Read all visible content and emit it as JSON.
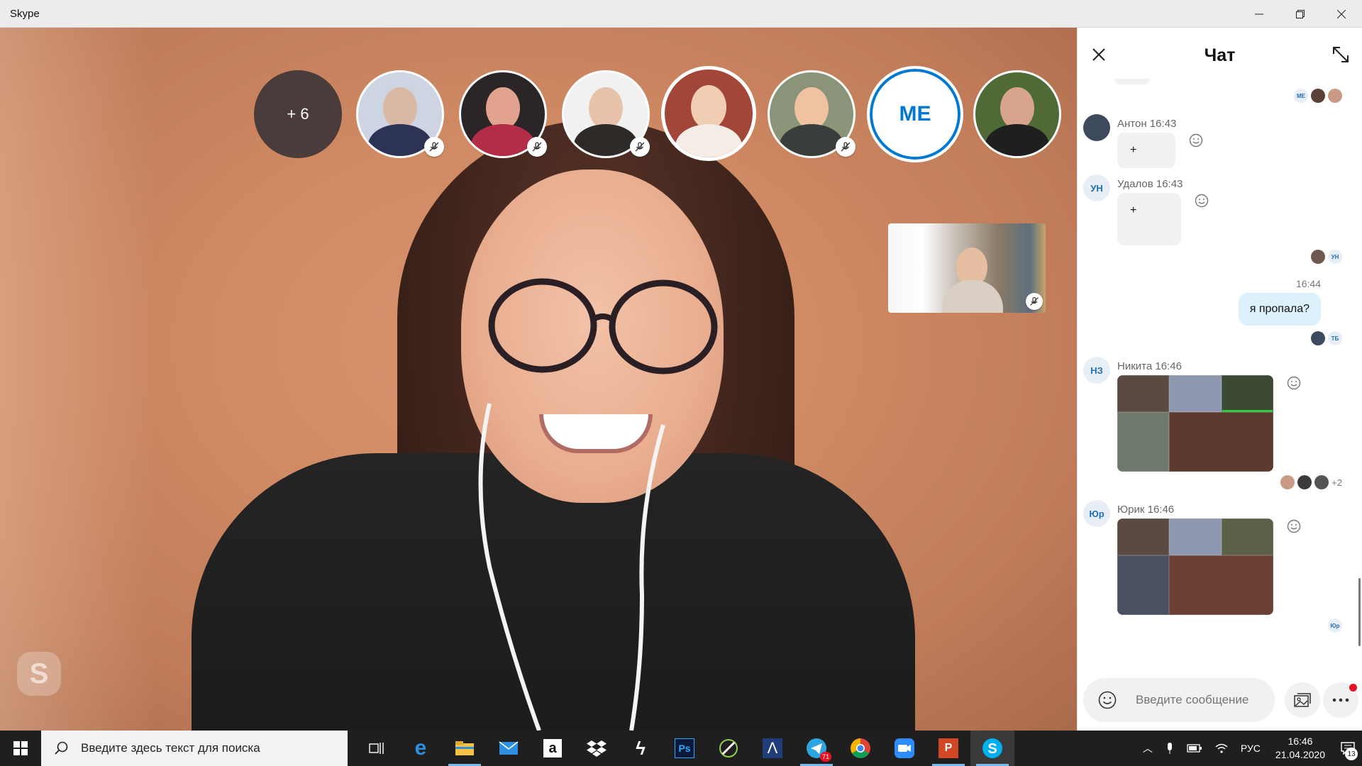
{
  "window": {
    "title": "Skype"
  },
  "call": {
    "more_count": "+ 6",
    "me_label": "ME",
    "participants": [
      {
        "id": "p1",
        "muted": true
      },
      {
        "id": "p2",
        "muted": true
      },
      {
        "id": "p3",
        "muted": true
      },
      {
        "id": "p4",
        "muted": false,
        "highlighted": true
      },
      {
        "id": "p5",
        "muted": true
      },
      {
        "id": "me",
        "muted": false
      },
      {
        "id": "p7",
        "muted": false
      }
    ]
  },
  "chat": {
    "title": "Чат",
    "messages": [
      {
        "sender": "Антон",
        "time": "16:43",
        "text": "+",
        "avatar": ""
      },
      {
        "sender": "Удалов",
        "time": "16:43",
        "text": "+",
        "avatar": "УН"
      },
      {
        "time": "16:44",
        "text": "я пропала?",
        "outgoing": true
      },
      {
        "sender": "Никита",
        "time": "16:46",
        "avatar": "НЗ",
        "type": "image"
      },
      {
        "sender": "Юрик",
        "time": "16:46",
        "avatar": "Юр",
        "type": "image"
      }
    ],
    "seen": {
      "top": [
        "МЕ",
        "",
        ""
      ],
      "udalov": [
        "",
        "УН"
      ],
      "out": [
        "",
        "ТБ"
      ],
      "nikita_extra": "+2",
      "yurik": [
        "Юр"
      ]
    },
    "composer": {
      "placeholder": "Введите сообщение"
    }
  },
  "taskbar": {
    "search_placeholder": "Введите здесь текст для поиска",
    "telegram_badge": "71",
    "lang": "РУС",
    "time": "16:46",
    "date": "21.04.2020",
    "notifications": "13"
  }
}
